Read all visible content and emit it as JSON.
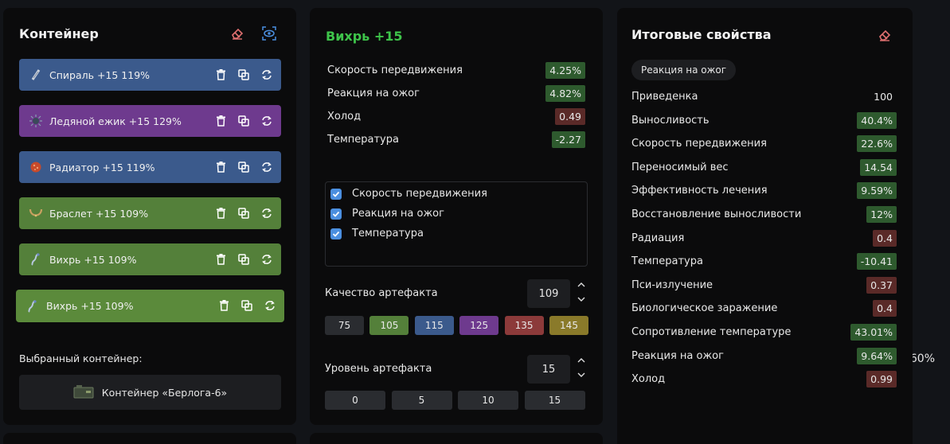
{
  "container_panel": {
    "title": "Контейнер",
    "items": [
      {
        "name": "Спираль +15 119%",
        "color": "#3b5a8c",
        "icon": "spiral-icon"
      },
      {
        "name": "Ледяной ежик +15 129%",
        "color": "#6e3a8e",
        "icon": "hedgehog-icon"
      },
      {
        "name": "Радиатор +15 119%",
        "color": "#3b5a8c",
        "icon": "radiator-icon"
      },
      {
        "name": "Браслет +15 109%",
        "color": "#54803a",
        "icon": "bracelet-icon"
      },
      {
        "name": "Вихрь +15 109%",
        "color": "#54803a",
        "icon": "whirl-icon"
      },
      {
        "name": "Вихрь +15 109%",
        "color": "#5b8a3b",
        "icon": "whirl-icon"
      }
    ],
    "selected_label": "Выбранный контейнер:",
    "slots": "6",
    "protection": "60%",
    "container_button": "Контейнер «Берлога-6»"
  },
  "artifact_panel": {
    "title": "Вихрь +15",
    "title_color": "#3ec44a",
    "stats": [
      {
        "label": "Скорость передвижения",
        "value": "4.25%",
        "kind": "pos"
      },
      {
        "label": "Реакция на ожог",
        "value": "4.82%",
        "kind": "pos"
      },
      {
        "label": "Холод",
        "value": "0.49",
        "kind": "neg"
      },
      {
        "label": "Температура",
        "value": "-2.27",
        "kind": "pos"
      }
    ],
    "checklist": [
      {
        "label": "Скорость передвижения",
        "checked": true
      },
      {
        "label": "Реакция на ожог",
        "checked": true
      },
      {
        "label": "Температура",
        "checked": true
      }
    ],
    "quality_label": "Качество артефакта",
    "quality_value": "109",
    "quality_options": [
      {
        "label": "75",
        "color": "#2a2c30"
      },
      {
        "label": "105",
        "color": "#54803a"
      },
      {
        "label": "115",
        "color": "#3b5a8c"
      },
      {
        "label": "125",
        "color": "#6e3a8e"
      },
      {
        "label": "135",
        "color": "#8c3a3a"
      },
      {
        "label": "145",
        "color": "#8a7a2a"
      }
    ],
    "level_label": "Уровень артефакта",
    "level_value": "15",
    "level_options": [
      "0",
      "5",
      "10",
      "15"
    ]
  },
  "total_panel": {
    "title": "Итоговые свойства",
    "chip": "Реакция на ожог",
    "stats": [
      {
        "label": "Приведенка",
        "value": "100",
        "kind": "plain"
      },
      {
        "label": "Выносливость",
        "value": "40.4%",
        "kind": "pos"
      },
      {
        "label": "Скорость передвижения",
        "value": "22.6%",
        "kind": "pos"
      },
      {
        "label": "Переносимый вес",
        "value": "14.54",
        "kind": "pos"
      },
      {
        "label": "Эффективность лечения",
        "value": "9.59%",
        "kind": "pos"
      },
      {
        "label": "Восстановление выносливости",
        "value": "12%",
        "kind": "pos"
      },
      {
        "label": "Радиация",
        "value": "0.4",
        "kind": "neg"
      },
      {
        "label": "Температура",
        "value": "-10.41",
        "kind": "pos"
      },
      {
        "label": "Пси-излучение",
        "value": "0.37",
        "kind": "neg"
      },
      {
        "label": "Биологическое заражение",
        "value": "0.4",
        "kind": "neg"
      },
      {
        "label": "Сопротивление температуре",
        "value": "43.01%",
        "kind": "pos"
      },
      {
        "label": "Реакция на ожог",
        "value": "9.64%",
        "kind": "pos"
      },
      {
        "label": "Холод",
        "value": "0.99",
        "kind": "neg"
      }
    ]
  }
}
